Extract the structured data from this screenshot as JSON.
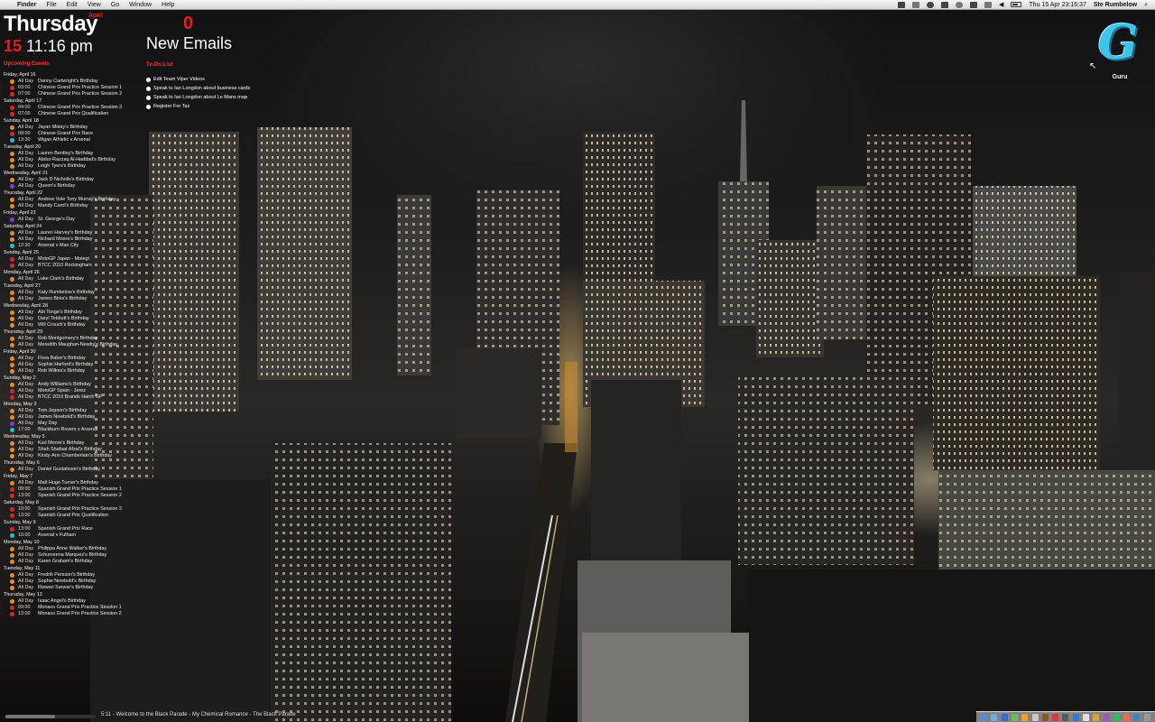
{
  "menubar": {
    "apple": "",
    "app_name": "Finder",
    "menus": [
      "File",
      "Edit",
      "View",
      "Go",
      "Window",
      "Help"
    ],
    "datetime": "Thu 15 Apr  23:16:37",
    "user": "Ste Rumbelow"
  },
  "clock": {
    "weekday": "Thursday",
    "month": "April",
    "date": "15",
    "time": "11:16 pm"
  },
  "email": {
    "count": "0",
    "label": "New Emails"
  },
  "events": {
    "title": "Upcoming Events",
    "colors": {
      "orange": "#f08a1c",
      "red": "#e02424",
      "purple": "#8a3bd6",
      "cyan": "#19c4e0"
    },
    "days": [
      {
        "date": "Friday, April 16",
        "items": [
          {
            "c": "orange",
            "time": "All Day",
            "name": "Danny Cartwright's Birthday"
          },
          {
            "c": "red",
            "time": "03:00",
            "name": "Chinese Grand Prix Practice Session 1"
          },
          {
            "c": "red",
            "time": "07:00",
            "name": "Chinese Grand Prix Practice Session 2"
          }
        ]
      },
      {
        "date": "Saturday, April 17",
        "items": [
          {
            "c": "red",
            "time": "04:00",
            "name": "Chinese Grand Prix Practice Session 3"
          },
          {
            "c": "red",
            "time": "07:00",
            "name": "Chinese Grand Prix Qualification"
          }
        ]
      },
      {
        "date": "Sunday, April 18",
        "items": [
          {
            "c": "orange",
            "time": "All Day",
            "name": "Jayan Mistry's Birthday"
          },
          {
            "c": "red",
            "time": "08:00",
            "name": "Chinese Grand Prix Race"
          },
          {
            "c": "cyan",
            "time": "13:30",
            "name": "Wigan Athletic v Arsenal"
          }
        ]
      },
      {
        "date": "Tuesday, April 20",
        "items": [
          {
            "c": "orange",
            "time": "All Day",
            "name": "Lauren Bentley's Birthday"
          },
          {
            "c": "orange",
            "time": "All Day",
            "name": "Abdur-Razzaq Al-Haddad's Birthday"
          },
          {
            "c": "orange",
            "time": "All Day",
            "name": "Leigh Tyers's Birthday"
          }
        ]
      },
      {
        "date": "Wednesday, April 21",
        "items": [
          {
            "c": "orange",
            "time": "All Day",
            "name": "Jack D Nicholls's Birthday"
          },
          {
            "c": "purple",
            "time": "All Day",
            "name": "Queen's Birthday"
          }
        ]
      },
      {
        "date": "Thursday, April 22",
        "items": [
          {
            "c": "orange",
            "time": "All Day",
            "name": "Andrew Vole Tony Murray's Birthday"
          },
          {
            "c": "orange",
            "time": "All Day",
            "name": "Mandy Carol's Birthday"
          }
        ]
      },
      {
        "date": "Friday, April 23",
        "items": [
          {
            "c": "purple",
            "time": "All Day",
            "name": "St. George's Day"
          }
        ]
      },
      {
        "date": "Saturday, April 24",
        "items": [
          {
            "c": "orange",
            "time": "All Day",
            "name": "Lauren Harvey's Birthday"
          },
          {
            "c": "orange",
            "time": "All Day",
            "name": "Richard Moore's Birthday"
          },
          {
            "c": "cyan",
            "time": "12:30",
            "name": "Arsenal v Man City"
          }
        ]
      },
      {
        "date": "Sunday, April 25",
        "items": [
          {
            "c": "red",
            "time": "All Day",
            "name": "MotoGP Japan - Motegi"
          },
          {
            "c": "red",
            "time": "All Day",
            "name": "BTCC 2010 Rockingham"
          }
        ]
      },
      {
        "date": "Monday, April 26",
        "items": [
          {
            "c": "orange",
            "time": "All Day",
            "name": "Luke Clark's Birthday"
          }
        ]
      },
      {
        "date": "Tuesday, April 27",
        "items": [
          {
            "c": "orange",
            "time": "All Day",
            "name": "Katy Rumbelow's Birthday"
          },
          {
            "c": "orange",
            "time": "All Day",
            "name": "James Birks's Birthday"
          }
        ]
      },
      {
        "date": "Wednesday, April 28",
        "items": [
          {
            "c": "orange",
            "time": "All Day",
            "name": "Abi Tonge's Birthday"
          },
          {
            "c": "orange",
            "time": "All Day",
            "name": "Daryl Tebbutt's Birthday"
          },
          {
            "c": "orange",
            "time": "All Day",
            "name": "Will Crouch's Birthday"
          }
        ]
      },
      {
        "date": "Thursday, April 29",
        "items": [
          {
            "c": "orange",
            "time": "All Day",
            "name": "Rob Montgomery's Birthday"
          },
          {
            "c": "orange",
            "time": "All Day",
            "name": "Meredith Maughan-Newby's Birthday"
          }
        ]
      },
      {
        "date": "Friday, April 30",
        "items": [
          {
            "c": "orange",
            "time": "All Day",
            "name": "Flora Baker's Birthday"
          },
          {
            "c": "orange",
            "time": "All Day",
            "name": "Sophie Harford's Birthday"
          },
          {
            "c": "orange",
            "time": "All Day",
            "name": "Rob Wilkes's Birthday"
          }
        ]
      },
      {
        "date": "Sunday, May 2",
        "items": [
          {
            "c": "orange",
            "time": "All Day",
            "name": "Andy Williams's Birthday"
          },
          {
            "c": "red",
            "time": "All Day",
            "name": "MotoGP Spain - Jerez"
          },
          {
            "c": "red",
            "time": "All Day",
            "name": "BTCC 2010 Brands Hatch GP"
          }
        ]
      },
      {
        "date": "Monday, May 3",
        "items": [
          {
            "c": "orange",
            "time": "All Day",
            "name": "Tom Jepson's Birthday"
          },
          {
            "c": "orange",
            "time": "All Day",
            "name": "James Newbold's Birthday"
          },
          {
            "c": "purple",
            "time": "All Day",
            "name": "May Day"
          },
          {
            "c": "cyan",
            "time": "17:00",
            "name": "Blackburn Rovers v Arsenal"
          }
        ]
      },
      {
        "date": "Wednesday, May 5",
        "items": [
          {
            "c": "orange",
            "time": "All Day",
            "name": "Karl Moore's Birthday"
          },
          {
            "c": "orange",
            "time": "All Day",
            "name": "Shah Shafaat Afzal's Birthday"
          },
          {
            "c": "orange",
            "time": "All Day",
            "name": "Kirsty-Ann Chamberlain's Birthday"
          }
        ]
      },
      {
        "date": "Thursday, May 6",
        "items": [
          {
            "c": "orange",
            "time": "All Day",
            "name": "Daniel Gustafsson's Birthday"
          }
        ]
      },
      {
        "date": "Friday, May 7",
        "items": [
          {
            "c": "orange",
            "time": "All Day",
            "name": "Matt Hugo Turner's Birthday"
          },
          {
            "c": "red",
            "time": "09:00",
            "name": "Spanish Grand Prix Practice Session 1"
          },
          {
            "c": "red",
            "time": "13:00",
            "name": "Spanish Grand Prix Practice Session 2"
          }
        ]
      },
      {
        "date": "Saturday, May 8",
        "items": [
          {
            "c": "red",
            "time": "10:00",
            "name": "Spanish Grand Prix Practice Session 3"
          },
          {
            "c": "red",
            "time": "13:00",
            "name": "Spanish Grand Prix Qualification"
          }
        ]
      },
      {
        "date": "Sunday, May 9",
        "items": [
          {
            "c": "red",
            "time": "13:00",
            "name": "Spanish Grand Prix Race"
          },
          {
            "c": "cyan",
            "time": "16:00",
            "name": "Arsenal v Fulham"
          }
        ]
      },
      {
        "date": "Monday, May 10",
        "items": [
          {
            "c": "orange",
            "time": "All Day",
            "name": "Philippa Anne Walker's Birthday"
          },
          {
            "c": "orange",
            "time": "All Day",
            "name": "Schumeena Marquez's Birthday"
          },
          {
            "c": "orange",
            "time": "All Day",
            "name": "Karen Graham's Birthday"
          }
        ]
      },
      {
        "date": "Tuesday, May 11",
        "items": [
          {
            "c": "orange",
            "time": "All Day",
            "name": "Fredrik Persson's Birthday"
          },
          {
            "c": "orange",
            "time": "All Day",
            "name": "Sophie Newbold's Birthday"
          },
          {
            "c": "orange",
            "time": "All Day",
            "name": "Rizwan Sarwar's Birthday"
          }
        ]
      },
      {
        "date": "Thursday, May 13",
        "items": [
          {
            "c": "orange",
            "time": "All Day",
            "name": "Isaac Angel's Birthday"
          },
          {
            "c": "red",
            "time": "09:00",
            "name": "Monaco Grand Prix Practice Session 1"
          },
          {
            "c": "red",
            "time": "13:00",
            "name": "Monaco Grand Prix Practice Session 2"
          }
        ]
      }
    ]
  },
  "todo": {
    "title": "To-Do List",
    "items": [
      "Edit Team Viper Videos",
      "Speak to Ian Longdon about business cards",
      "Speak to Ian Longdon about Le Mans map",
      "Register For Tax"
    ]
  },
  "desktop_icon": {
    "icon": "guru-g-icon",
    "label": "Guru"
  },
  "nowplaying": {
    "text": "5:11 - Welcome to the Black Parade - My Chemical Romance - The Black Parade",
    "progress": 0.55
  }
}
